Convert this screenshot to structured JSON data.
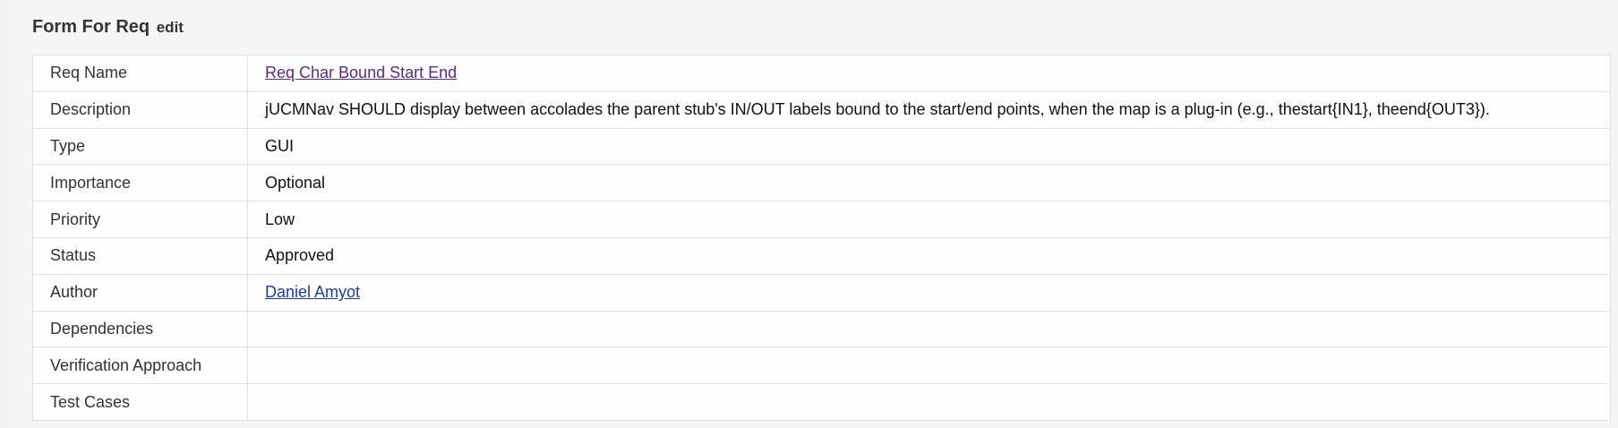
{
  "form": {
    "title": "Form For Req",
    "edit_label": "edit"
  },
  "fields": {
    "req_name": {
      "label": "Req Name",
      "value": "Req Char Bound Start End"
    },
    "description": {
      "label": "Description",
      "value": "jUCMNav SHOULD display between accolades the parent stub's IN/OUT labels bound to the start/end points, when the map is a plug-in (e.g., thestart{IN1}, theend{OUT3})."
    },
    "type": {
      "label": "Type",
      "value": "GUI"
    },
    "importance": {
      "label": "Importance",
      "value": "Optional"
    },
    "priority": {
      "label": "Priority",
      "value": "Low"
    },
    "status": {
      "label": "Status",
      "value": "Approved"
    },
    "author": {
      "label": "Author",
      "value": "Daniel Amyot"
    },
    "dependencies": {
      "label": "Dependencies",
      "value": ""
    },
    "verification_approach": {
      "label": "Verification Approach",
      "value": ""
    },
    "test_cases": {
      "label": "Test Cases",
      "value": ""
    }
  },
  "colors": {
    "visited_link": "#5b2a86",
    "link": "#1a3f9a",
    "background": "#f2f2f2",
    "table_background": "#fdfdfd",
    "border": "#e1e1e1"
  }
}
